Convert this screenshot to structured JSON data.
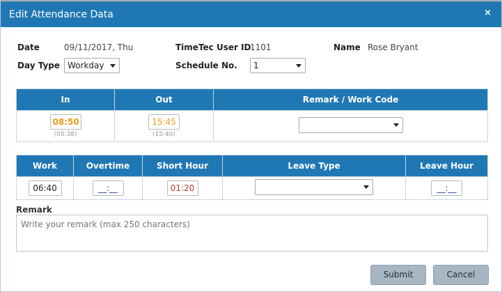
{
  "dialog": {
    "title": "Edit Attendance Data",
    "close_label": "×"
  },
  "info": {
    "date_label": "Date",
    "date_value": "09/11/2017, Thu",
    "user_id_label": "TimeTec User ID",
    "user_id_value": "1101",
    "name_label": "Name",
    "name_value": "Rose Bryant",
    "day_type_label": "Day Type",
    "day_type_value": "Workday",
    "schedule_label": "Schedule No.",
    "schedule_value": "1"
  },
  "in_out_table": {
    "headers": {
      "in": "In",
      "out": "Out",
      "remark_work_code": "Remark / Work Code"
    },
    "in_value": "08:50",
    "in_original": "(08:38)",
    "out_value": "15:45",
    "out_original": "(15:40)",
    "work_code_value": ""
  },
  "hours_table": {
    "headers": {
      "work": "Work",
      "overtime": "Overtime",
      "short_hour": "Short Hour",
      "leave_type": "Leave Type",
      "leave_hour": "Leave Hour"
    },
    "work_value": "06:40",
    "overtime_value": "__:__",
    "short_hour_value": "01:20",
    "leave_type_value": "",
    "leave_hour_value": "__:__"
  },
  "remark": {
    "label": "Remark",
    "placeholder": "Write your remark (max 250 characters)"
  },
  "buttons": {
    "submit": "Submit",
    "cancel": "Cancel"
  },
  "colors": {
    "header_blue": "#1f78b4",
    "time_orange": "#e89b1c",
    "short_red": "#c0392b",
    "button_gray": "#a7b6c2"
  }
}
